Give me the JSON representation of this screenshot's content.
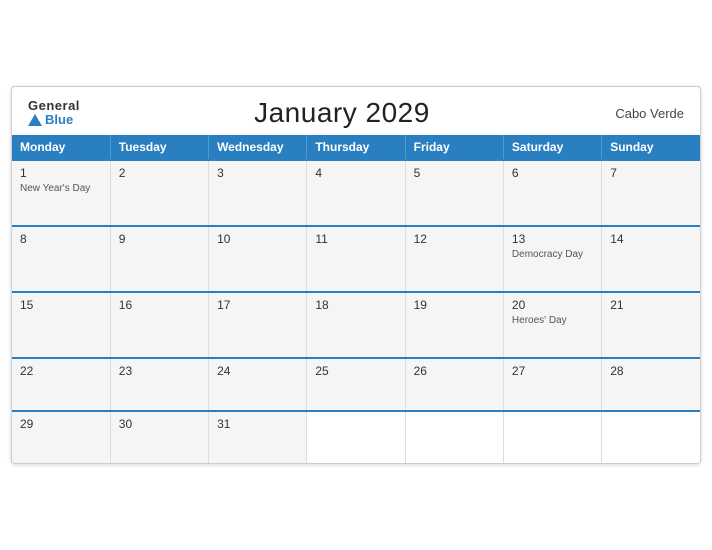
{
  "header": {
    "logo_general": "General",
    "logo_blue": "Blue",
    "title": "January 2029",
    "country": "Cabo Verde"
  },
  "weekdays": [
    "Monday",
    "Tuesday",
    "Wednesday",
    "Thursday",
    "Friday",
    "Saturday",
    "Sunday"
  ],
  "weeks": [
    [
      {
        "day": "1",
        "event": "New Year's Day"
      },
      {
        "day": "2",
        "event": ""
      },
      {
        "day": "3",
        "event": ""
      },
      {
        "day": "4",
        "event": ""
      },
      {
        "day": "5",
        "event": ""
      },
      {
        "day": "6",
        "event": ""
      },
      {
        "day": "7",
        "event": ""
      }
    ],
    [
      {
        "day": "8",
        "event": ""
      },
      {
        "day": "9",
        "event": ""
      },
      {
        "day": "10",
        "event": ""
      },
      {
        "day": "11",
        "event": ""
      },
      {
        "day": "12",
        "event": ""
      },
      {
        "day": "13",
        "event": "Democracy Day"
      },
      {
        "day": "14",
        "event": ""
      }
    ],
    [
      {
        "day": "15",
        "event": ""
      },
      {
        "day": "16",
        "event": ""
      },
      {
        "day": "17",
        "event": ""
      },
      {
        "day": "18",
        "event": ""
      },
      {
        "day": "19",
        "event": ""
      },
      {
        "day": "20",
        "event": "Heroes' Day"
      },
      {
        "day": "21",
        "event": ""
      }
    ],
    [
      {
        "day": "22",
        "event": ""
      },
      {
        "day": "23",
        "event": ""
      },
      {
        "day": "24",
        "event": ""
      },
      {
        "day": "25",
        "event": ""
      },
      {
        "day": "26",
        "event": ""
      },
      {
        "day": "27",
        "event": ""
      },
      {
        "day": "28",
        "event": ""
      }
    ],
    [
      {
        "day": "29",
        "event": ""
      },
      {
        "day": "30",
        "event": ""
      },
      {
        "day": "31",
        "event": ""
      },
      {
        "day": "",
        "event": ""
      },
      {
        "day": "",
        "event": ""
      },
      {
        "day": "",
        "event": ""
      },
      {
        "day": "",
        "event": ""
      }
    ]
  ]
}
